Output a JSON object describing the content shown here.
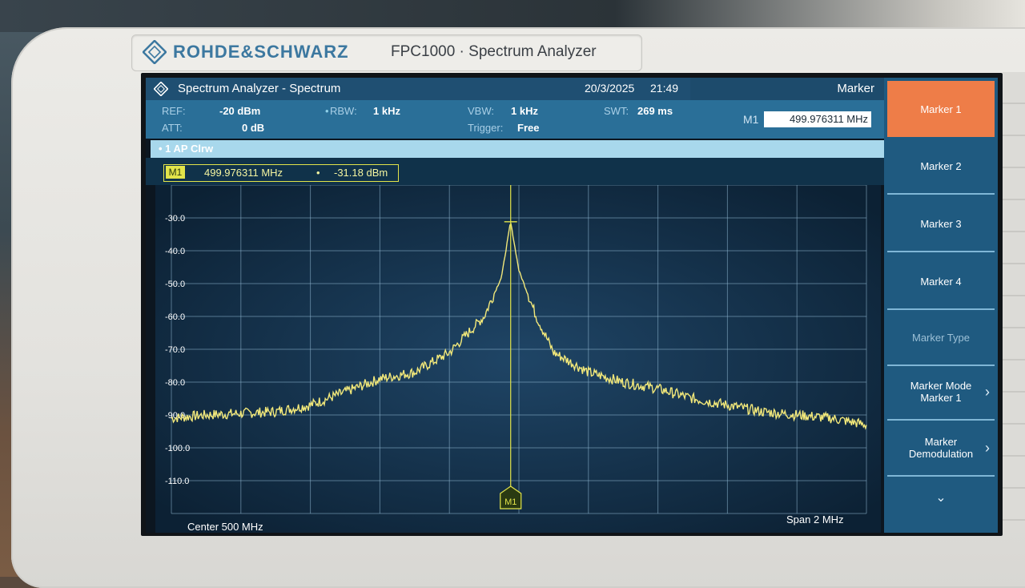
{
  "device": {
    "brand": "ROHDE&SCHWARZ",
    "model": "FPC1000 · Spectrum Analyzer"
  },
  "titlebar": {
    "title": "Spectrum Analyzer - Spectrum",
    "date": "20/3/2025",
    "time": "21:49",
    "panel_title": "Marker"
  },
  "settings": {
    "ref_label": "REF:",
    "ref_value": "-20 dBm",
    "att_label": "ATT:",
    "att_value": "0 dB",
    "rbw_label": "RBW:",
    "rbw_value": "1 kHz",
    "vbw_label": "VBW:",
    "vbw_value": "1 kHz",
    "trigger_label": "Trigger:",
    "trigger_value": "Free",
    "swt_label": "SWT:",
    "swt_value": "269 ms",
    "m1_label": "M1",
    "m1_value": "499.976311 MHz"
  },
  "trace": {
    "label": "• 1 AP Clrw"
  },
  "marker_readout": {
    "tag": "M1",
    "frequency": "499.976311 MHz",
    "separator": "•",
    "level": "-31.18 dBm"
  },
  "plot": {
    "center": "Center 500 MHz",
    "span": "Span 2 MHz",
    "marker_tag": "M1",
    "y_ticks": [
      "-30.0",
      "-40.0",
      "-50.0",
      "-60.0",
      "-70.0",
      "-80.0",
      "-90.0",
      "-100.0",
      "-110.0"
    ]
  },
  "softkeys": [
    {
      "label": "Marker 1",
      "state": "active"
    },
    {
      "label": "Marker 2",
      "state": "normal"
    },
    {
      "label": "Marker 3",
      "state": "normal"
    },
    {
      "label": "Marker 4",
      "state": "normal"
    },
    {
      "label": "Marker Type",
      "state": "disabled"
    },
    {
      "label": "Marker Mode",
      "label2": "Marker 1",
      "state": "normal",
      "chevron": "›"
    },
    {
      "label": "Marker",
      "label2": "Demodulation",
      "state": "normal",
      "chevron": "›"
    }
  ],
  "softkey_more": "⌄",
  "chart_data": {
    "type": "line",
    "x_unit": "MHz",
    "x_range": [
      499.0,
      501.0
    ],
    "ylim": [
      -120,
      -20
    ],
    "y_unit": "dBm",
    "series": [
      {
        "color": "#f2e87a",
        "points": [
          [
            499.0,
            -91
          ],
          [
            499.1,
            -90
          ],
          [
            499.2,
            -89.5
          ],
          [
            499.3,
            -89
          ],
          [
            499.4,
            -87
          ],
          [
            499.5,
            -83
          ],
          [
            499.6,
            -79
          ],
          [
            499.7,
            -77
          ],
          [
            499.8,
            -71
          ],
          [
            499.9,
            -60
          ],
          [
            499.95,
            -48
          ],
          [
            499.976,
            -31.18
          ],
          [
            500.0,
            -46
          ],
          [
            500.05,
            -60
          ],
          [
            500.1,
            -71
          ],
          [
            500.2,
            -77
          ],
          [
            500.3,
            -80
          ],
          [
            500.4,
            -82
          ],
          [
            500.5,
            -85
          ],
          [
            500.6,
            -87
          ],
          [
            500.7,
            -89
          ],
          [
            500.8,
            -90
          ],
          [
            500.9,
            -91
          ],
          [
            501.0,
            -93
          ]
        ]
      }
    ],
    "marker": {
      "name": "M1",
      "x": 499.976311,
      "y": -31.18,
      "color": "#e2e44a"
    },
    "grid": true
  }
}
